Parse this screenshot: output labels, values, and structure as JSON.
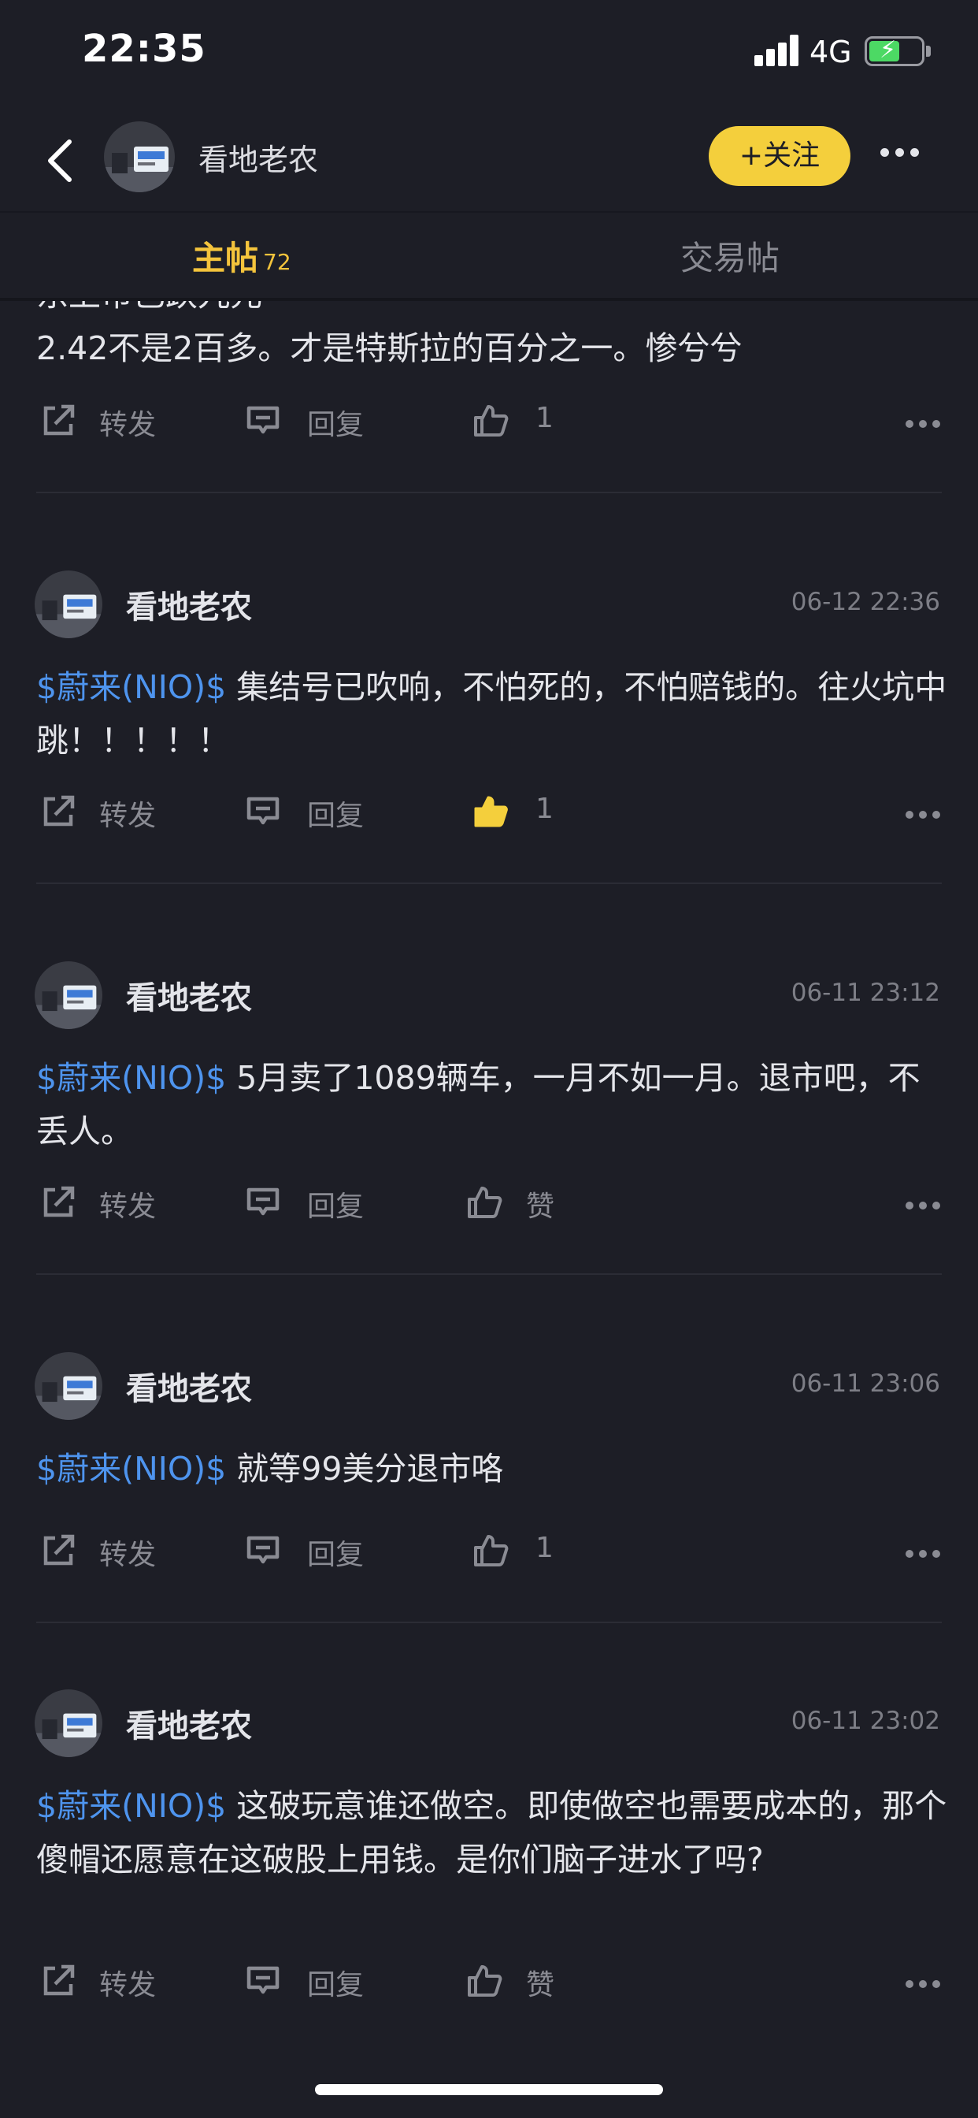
{
  "status_bar": {
    "time": "22:35",
    "network": "4G"
  },
  "nav": {
    "user_name": "看地老农",
    "follow_label": "+关注"
  },
  "tabs": {
    "main_label": "主帖",
    "main_count": "72",
    "trade_label": "交易帖"
  },
  "posts": [
    {
      "author": "",
      "time": "",
      "ticker": "",
      "text_line1": "东上市已跌九元",
      "text_line2": "2.42不是2百多。才是特斯拉的百分之一。惨兮兮",
      "repost_label": "转发",
      "reply_label": "回复",
      "like_value": "1",
      "liked": false
    },
    {
      "author": "看地老农",
      "time": "06-12 22:36",
      "ticker": "$蔚来(NIO)$",
      "text": " 集结号已吹响，不怕死的，不怕赔钱的。往火坑中跳！！！！！",
      "repost_label": "转发",
      "reply_label": "回复",
      "like_value": "1",
      "liked": true
    },
    {
      "author": "看地老农",
      "time": "06-11 23:12",
      "ticker": "$蔚来(NIO)$",
      "text": " 5月卖了1089辆车，一月不如一月。退市吧，不丢人。",
      "repost_label": "转发",
      "reply_label": "回复",
      "like_value": "赞",
      "liked": false
    },
    {
      "author": "看地老农",
      "time": "06-11 23:06",
      "ticker": "$蔚来(NIO)$",
      "text": " 就等99美分退市咯",
      "repost_label": "转发",
      "reply_label": "回复",
      "like_value": "1",
      "liked": false
    },
    {
      "author": "看地老农",
      "time": "06-11 23:02",
      "ticker": "$蔚来(NIO)$",
      "text": " 这破玩意谁还做空。即使做空也需要成本的，那个傻帽还愿意在这破股上用钱。是你们脑子进水了吗?",
      "repost_label": "转发",
      "reply_label": "回复",
      "like_value": "赞",
      "liked": false
    }
  ],
  "colors": {
    "accent": "#f4cf3c",
    "ticker": "#4e94ee",
    "background": "#1d1e26"
  },
  "icons": [
    "back-icon",
    "more-icon",
    "share-icon",
    "comment-icon",
    "thumbs-up-icon"
  ]
}
